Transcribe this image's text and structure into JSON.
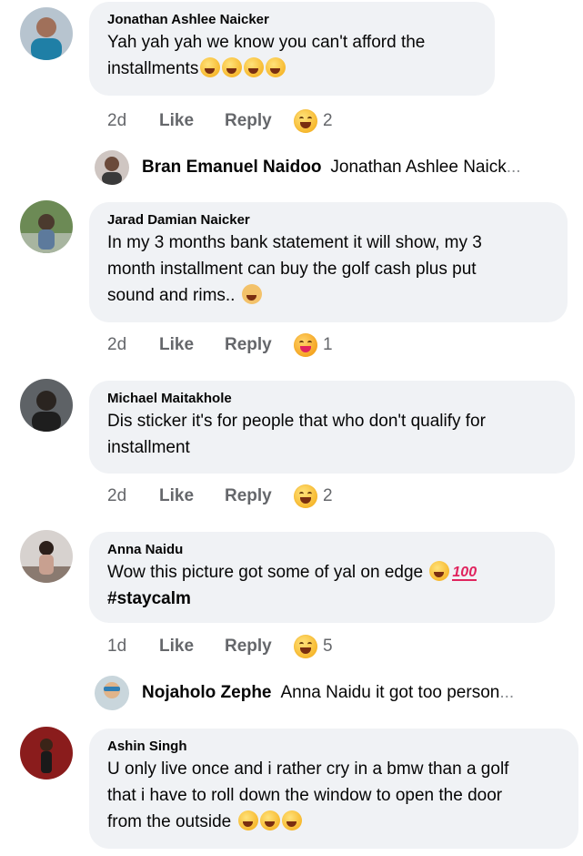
{
  "comments": [
    {
      "author": "Jonathan Ashlee Naicker",
      "text_lines": [
        "Yah yah yah we know you can't afford the",
        "installments"
      ],
      "time": "2d",
      "like": "Like",
      "reply": "Reply",
      "reaction_count": "2"
    },
    {
      "author": "Jarad Damian Naicker",
      "text_lines": [
        "In my 3 months bank statement it will show, my 3",
        "month installment can buy the golf cash plus put",
        "sound and rims.."
      ],
      "time": "2d",
      "like": "Like",
      "reply": "Reply",
      "reaction_count": "1"
    },
    {
      "author": "Michael Maitakhole",
      "text_lines": [
        "Dis sticker it's for people that who don't qualify for",
        "installment"
      ],
      "time": "2d",
      "like": "Like",
      "reply": "Reply",
      "reaction_count": "2"
    },
    {
      "author": "Anna Naidu",
      "text_lines": [
        "Wow this picture got some of yal on edge",
        "#staycalm"
      ],
      "time": "1d",
      "like": "Like",
      "reply": "Reply",
      "reaction_count": "5"
    },
    {
      "author": "Ashin Singh",
      "text_lines": [
        "U only live once and i rather cry in a bmw than a golf",
        "that i have to roll down the window to open the door",
        "from the outside"
      ]
    }
  ],
  "replies": [
    {
      "name": "Bran Emanuel Naidoo",
      "preview": "Jonathan Ashlee Naick",
      "ellipsis": "..."
    },
    {
      "name": "Nojaholo Zephe",
      "preview": "Anna Naidu it got too person",
      "ellipsis": "..."
    }
  ],
  "icons": {
    "laugh_reaction": "laughing-face-icon",
    "love_reaction": "care-face-icon",
    "hundred_emoji": "100"
  },
  "colors": {
    "bubble": "#f0f2f5",
    "meta": "#65676b",
    "text": "#050505"
  }
}
